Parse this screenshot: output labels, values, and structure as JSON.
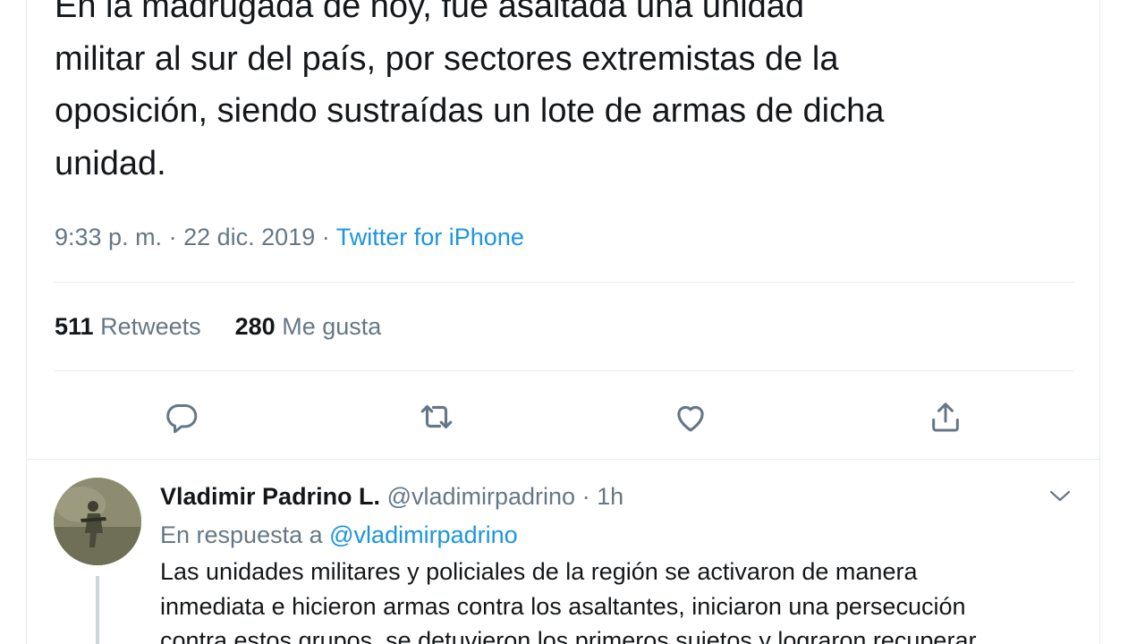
{
  "main_tweet": {
    "text": "En la madrugada de hoy, fue asaltada una unidad\nmilitar al sur del país, por sectores extremistas de la\noposición, siendo sustraídas un lote de armas de dicha\nunidad.",
    "time": "9:33 p. m.",
    "separator": "·",
    "date": "22 dic. 2019",
    "source": "Twitter for iPhone",
    "retweets_count": "511",
    "retweets_label": "Retweets",
    "likes_count": "280",
    "likes_label": "Me gusta"
  },
  "actions": {
    "icons": [
      "reply-icon",
      "retweet-icon",
      "like-icon",
      "share-icon"
    ]
  },
  "reply_tweet": {
    "name": "Vladimir Padrino L.",
    "handle": "@vladimirpadrino",
    "separator": "·",
    "time": "1h",
    "reply_prefix": "En respuesta a",
    "reply_mention": "@vladimirpadrino",
    "text": "Las unidades militares y policiales de la región se activaron de manera\ninmediata e hicieron armas contra los asaltantes, iniciaron una persecución\ncontra estos grupos, se detuvieron los primeros sujetos y lograron recuperar"
  },
  "colors": {
    "text": "#14171a",
    "secondary": "#657786",
    "link": "#1b95e0",
    "divider": "#e6ecf0"
  }
}
